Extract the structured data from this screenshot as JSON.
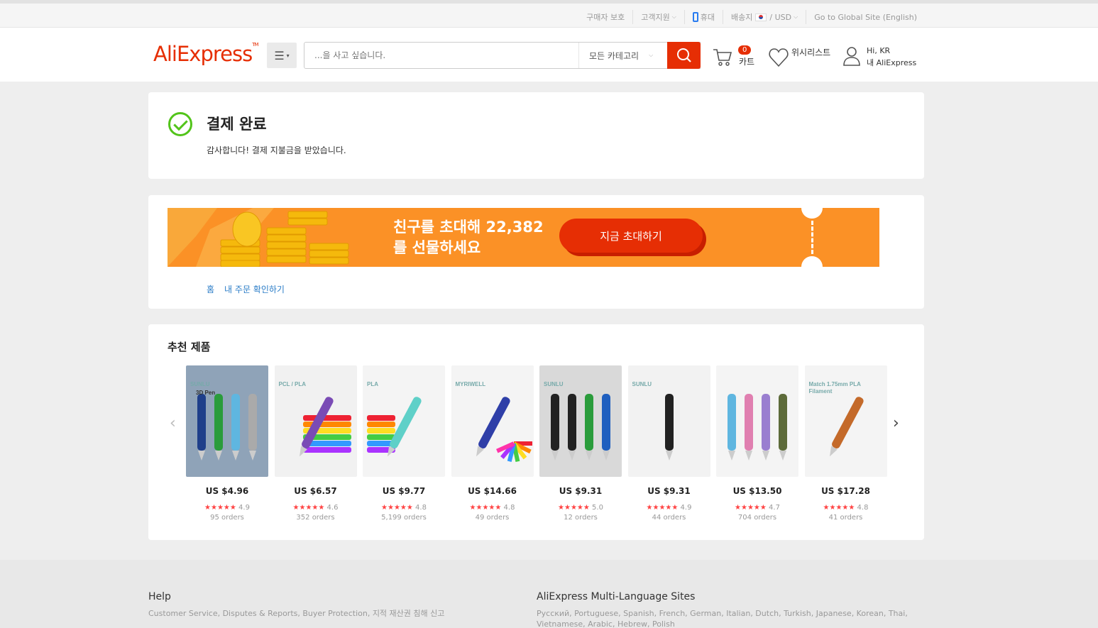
{
  "topbar": {
    "buyer_protection": "구매자 보호",
    "support": "고객지원",
    "mobile": "휴대",
    "ship_to": "배송지",
    "currency_sep": "/",
    "currency": "USD",
    "global_site": "Go to Global Site (English)"
  },
  "header": {
    "logo": "AliExpress",
    "search_placeholder": "...을 사고 싶습니다.",
    "category": "모든 카테고리",
    "cart_count": "0",
    "cart_label": "카트",
    "wishlist_label": "위시리스트",
    "greeting": "Hi, KR",
    "account_label": "내 AliExpress"
  },
  "payment": {
    "title": "결제 완료",
    "message": "감사합니다! 결제 지불금을 받았습니다."
  },
  "invite": {
    "line1": "친구를 초대해 22,382",
    "line2": "를 선물하세요",
    "button": "지금 초대하기",
    "crumb_home": "홈",
    "crumb_orders": "내 주문 확인하기"
  },
  "recommend": {
    "title": "추천 제품",
    "products": [
      {
        "price": "US $4.96",
        "stars": "★★★★★",
        "rating": "4.9",
        "orders": "95 orders",
        "brand": "SUNLU",
        "subtitle": "3D Pen",
        "bg": "#8fa3b8"
      },
      {
        "price": "US $6.57",
        "stars": "★★★★★",
        "rating": "4.6",
        "orders": "352 orders",
        "brand": "PCL / PLA",
        "subtitle": "",
        "bg": "#f1f1f1"
      },
      {
        "price": "US $9.77",
        "stars": "★★★★★",
        "rating": "4.8",
        "orders": "5,199 orders",
        "brand": "PLA",
        "subtitle": "",
        "bg": "#f4f4f4"
      },
      {
        "price": "US $14.66",
        "stars": "★★★★★",
        "rating": "4.8",
        "orders": "49 orders",
        "brand": "MYRIWELL",
        "subtitle": "",
        "bg": "#f4f4f4"
      },
      {
        "price": "US $9.31",
        "stars": "★★★★★",
        "rating": "5.0",
        "orders": "12 orders",
        "brand": "SUNLU",
        "subtitle": "",
        "bg": "#d9d9d9"
      },
      {
        "price": "US $9.31",
        "stars": "★★★★★",
        "rating": "4.9",
        "orders": "44 orders",
        "brand": "SUNLU",
        "subtitle": "",
        "bg": "#f2f2f2"
      },
      {
        "price": "US $13.50",
        "stars": "★★★★★",
        "rating": "4.7",
        "orders": "704 orders",
        "brand": "",
        "subtitle": "",
        "bg": "#f4f4f4"
      },
      {
        "price": "US $17.28",
        "stars": "★★★★★",
        "rating": "4.8",
        "orders": "41 orders",
        "brand": "Match 1.75mm PLA Filament",
        "subtitle": "",
        "bg": "#f4f4f4"
      }
    ]
  },
  "footer": {
    "help_title": "Help",
    "help_text": "Customer Service, Disputes & Reports, Buyer Protection, 지적 재산권 침해 신고",
    "lang_title": "AliExpress Multi-Language Sites",
    "lang_text": "Русский, Portuguese, Spanish, French, German, Italian, Dutch, Turkish, Japanese, Korean, Thai, Vietnamese, Arabic, Hebrew, Polish"
  },
  "colors": {
    "brand": "#e62e04",
    "banner": "#fb9126",
    "success": "#52c41a",
    "link": "#2a7cc7",
    "stars": "#ff4444"
  }
}
